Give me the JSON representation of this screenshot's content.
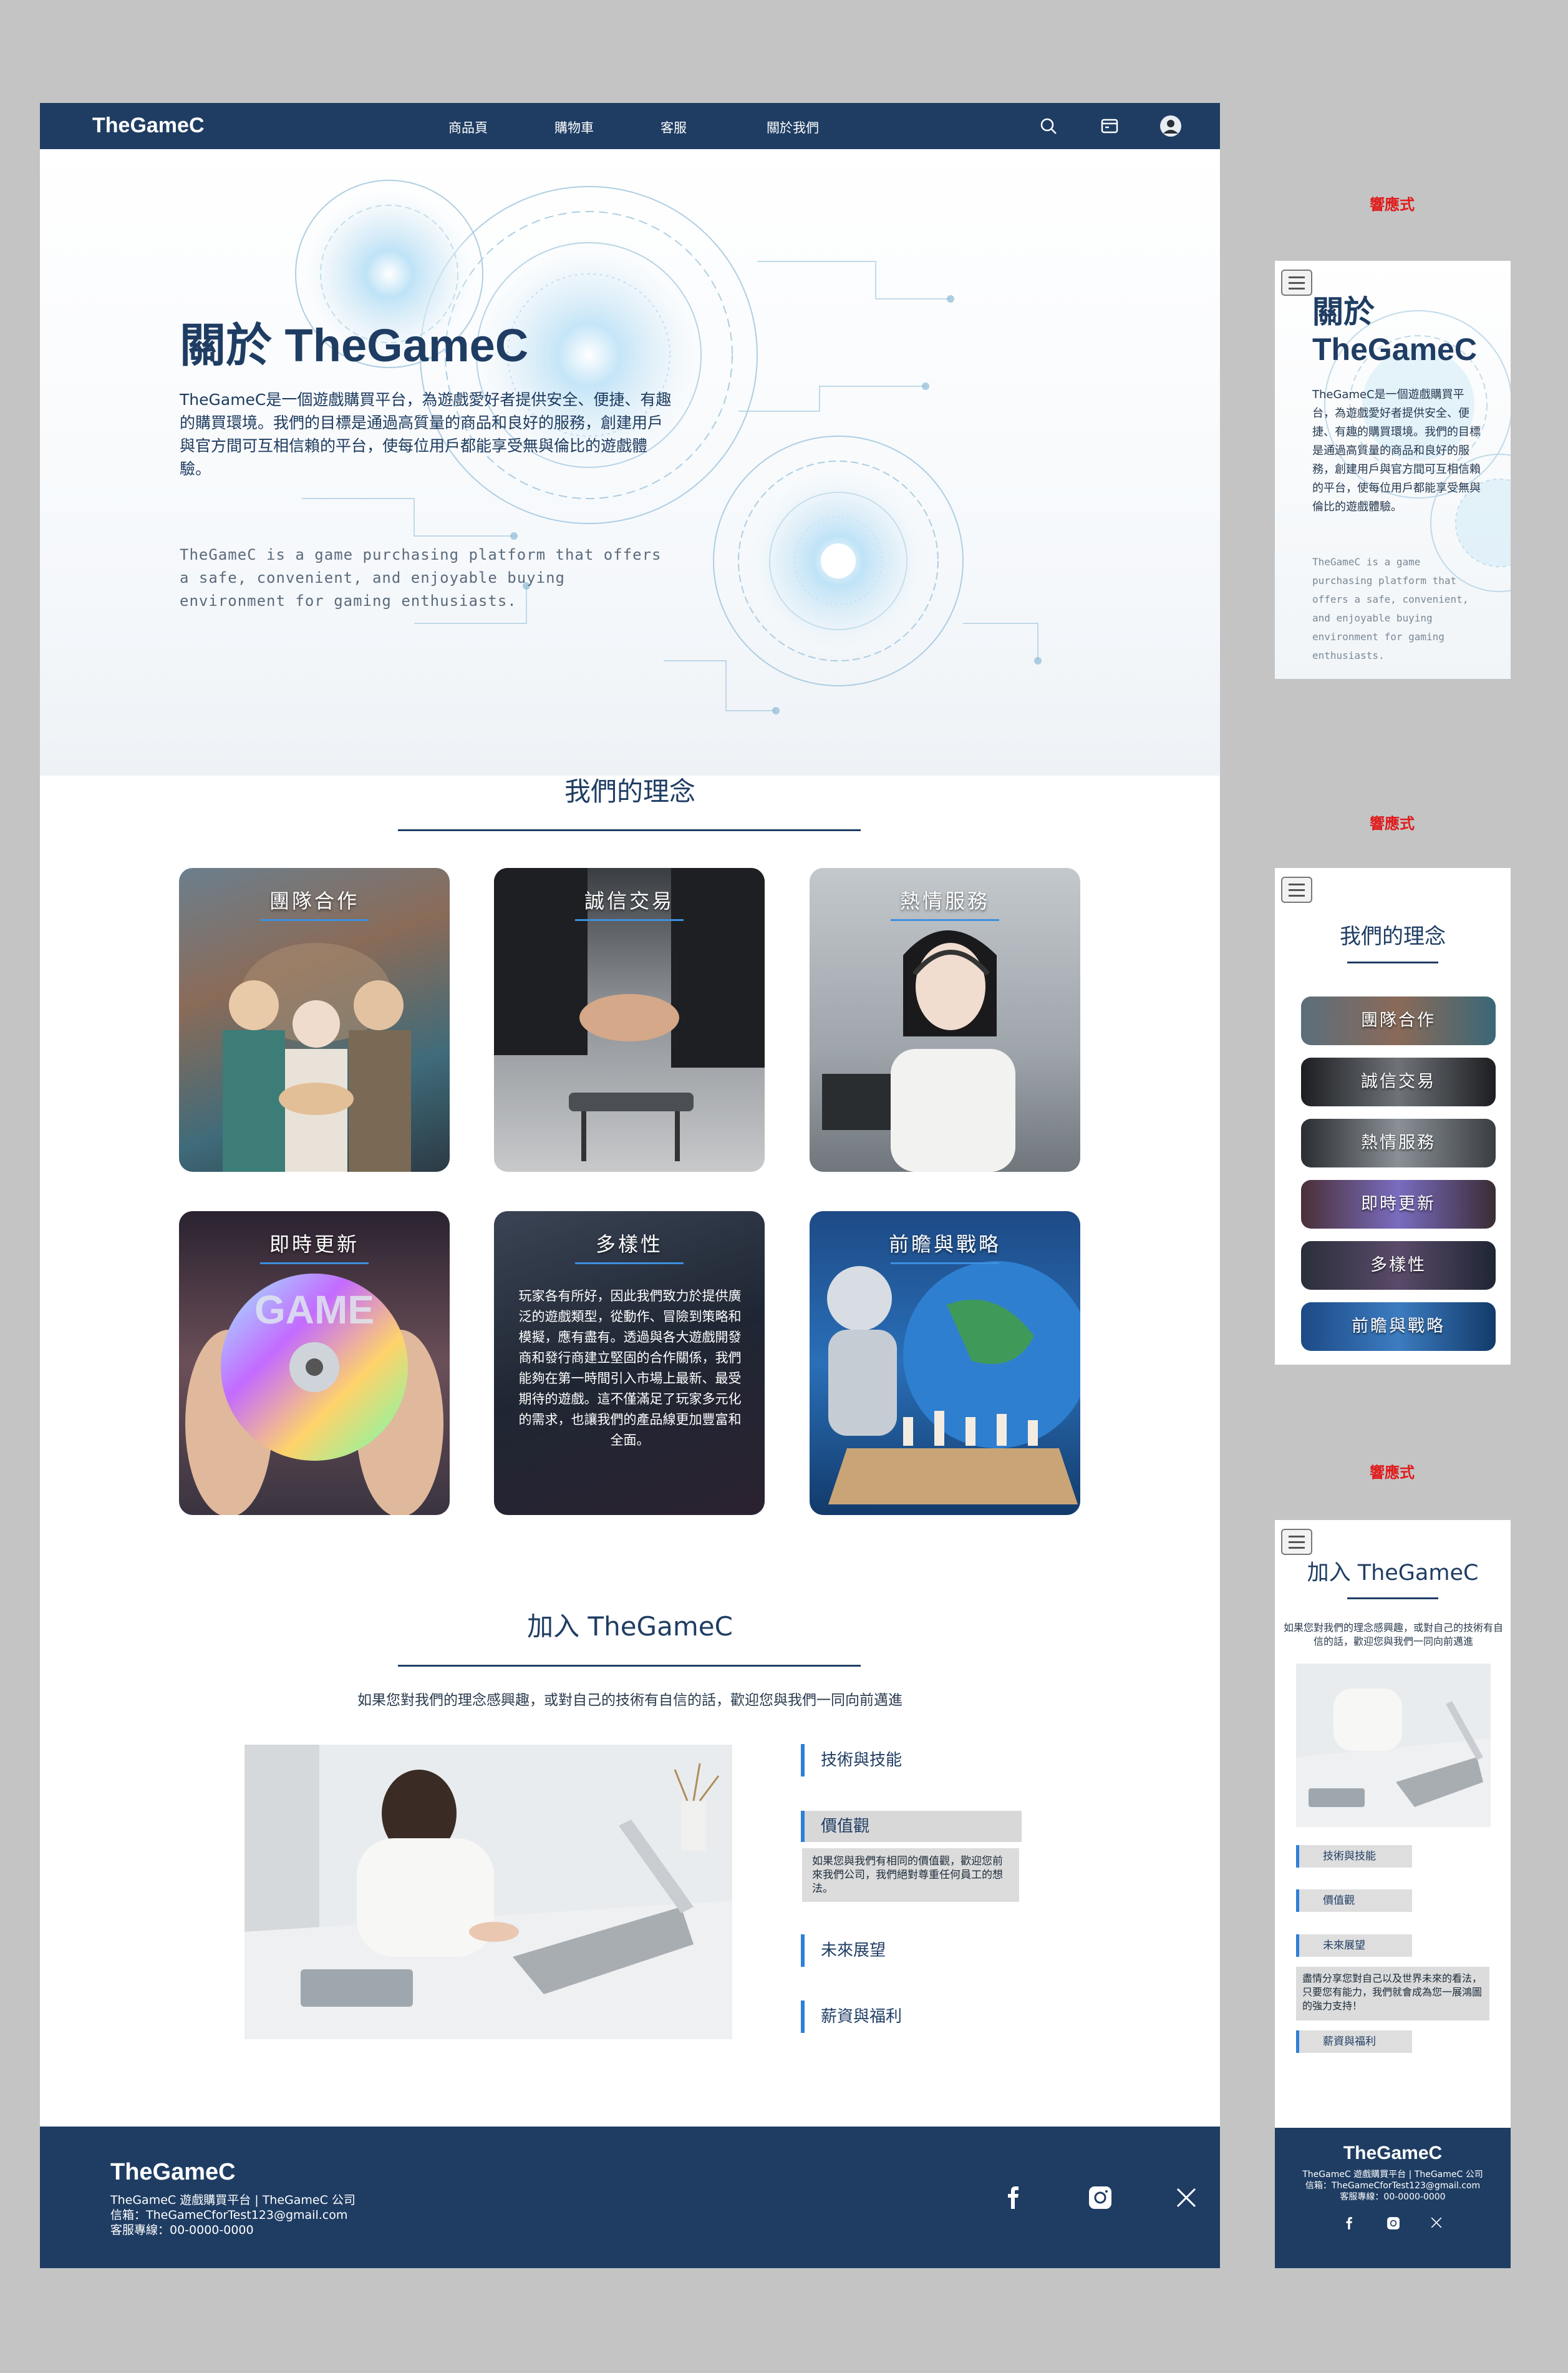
{
  "nav": {
    "logo": "TheGameC",
    "menu": [
      "商品頁",
      "購物車",
      "客服",
      "關於我們"
    ],
    "icons": [
      "search-icon",
      "cart-icon",
      "avatar"
    ]
  },
  "hero": {
    "title": "關於 TheGameC",
    "zh": "TheGameC是一個遊戲購買平台，為遊戲愛好者提供安全、便捷、有趣的購買環境。我們的目標是通過高質量的商品和良好的服務，創建用戶與官方間可互相信賴的平台，使每位用戶都能享受無與倫比的遊戲體驗。",
    "en": "TheGameC is a game purchasing platform that offers a safe, convenient, and enjoyable buying environment for gaming enthusiasts."
  },
  "philosophy": {
    "title": "我們的理念",
    "cards": [
      {
        "title": "團隊合作"
      },
      {
        "title": "誠信交易"
      },
      {
        "title": "熱情服務"
      },
      {
        "title": "即時更新"
      },
      {
        "title": "多樣性",
        "text": "玩家各有所好，因此我們致力於提供廣泛的遊戲類型，從動作、冒險到策略和模擬，應有盡有。透過與各大遊戲開發商和發行商建立堅固的合作關係，我們能夠在第一時間引入市場上最新、最受期待的遊戲。這不僅滿足了玩家多元化的需求，也讓我們的產品線更加豐富和全面。"
      },
      {
        "title": "前瞻與戰略"
      }
    ]
  },
  "join": {
    "title": "加入 TheGameC",
    "subtitle": "如果您對我們的理念感興趣，或對自己的技術有自信的話，歡迎您與我們一同向前邁進",
    "items": [
      "技術與技能",
      "價值觀",
      "未來展望",
      "薪資與福利"
    ],
    "open_text": "如果您與我們有相同的價值觀，歡迎您前來我們公司，我們絕對尊重任何員工的想法。"
  },
  "footer": {
    "logo": "TheGameC",
    "line1": "TheGameC 遊戲購買平台 | TheGameC 公司",
    "line2": "信箱：TheGameCforTest123@gmail.com",
    "line3": "客服專線：00-0000-0000",
    "icons": [
      "facebook-icon",
      "instagram-icon",
      "x-icon"
    ]
  },
  "responsive_label": "響應式",
  "mobile": {
    "about": {
      "title_line1": "關於",
      "title_line2": "TheGameC",
      "zh": "TheGameC是一個遊戲購買平台，為遊戲愛好者提供安全、便捷、有趣的購買環境。我們的目標是通過高質量的商品和良好的服務，創建用戶與官方間可互相信賴的平台，使每位用戶都能享受無與倫比的遊戲體驗。",
      "en": "TheGameC is a game purchasing platform that offers a safe, convenient, and enjoyable buying environment for gaming enthusiasts."
    },
    "philosophy_title": "我們的理念",
    "pills": [
      "團隊合作",
      "誠信交易",
      "熱情服務",
      "即時更新",
      "多樣性",
      "前瞻與戰略"
    ],
    "join_title": "加入 TheGameC",
    "join_sub": "如果您對我們的理念感興趣，或對自己的技術有自信的話，歡迎您與我們一同向前邁進",
    "items": [
      "技術與技能",
      "價值觀",
      "未來展望",
      "薪資與福利"
    ],
    "open_text": "盡情分享您對自己以及世界未來的看法，只要您有能力，我們就會成為您一展鴻圖的強力支持！",
    "footer_line1": "TheGameC 遊戲購買平台 | TheGameC 公司",
    "footer_line2": "信箱：TheGameCforTest123@gmail.com",
    "footer_line3": "客服專線：00-0000-0000"
  },
  "colors": {
    "navy": "#1f3d63",
    "accent": "#2f7fd8",
    "label_red": "#e01a1a"
  }
}
